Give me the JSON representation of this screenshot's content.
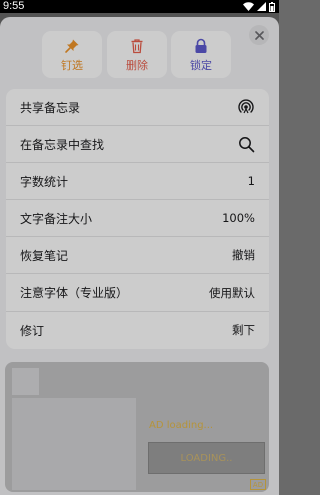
{
  "status_bar": {
    "time": "9:55"
  },
  "actions": {
    "pin": {
      "label": "钉选",
      "color": "#f0952a"
    },
    "delete": {
      "label": "删除",
      "color": "#e95f4d"
    },
    "lock": {
      "label": "锁定",
      "color": "#5e5bd0"
    }
  },
  "menu": {
    "items": [
      {
        "label": "共享备忘录",
        "value": "",
        "icon": "share-icon"
      },
      {
        "label": "在备忘录中查找",
        "value": "",
        "icon": "search-icon"
      },
      {
        "label": "字数统计",
        "value": "1"
      },
      {
        "label": "文字备注大小",
        "value": "100%"
      },
      {
        "label": "恢复笔记",
        "value": "撤销"
      },
      {
        "label": "注意字体（专业版）",
        "value": "使用默认"
      },
      {
        "label": "修订",
        "value": "剩下"
      }
    ]
  },
  "ad": {
    "loading_text": "AD loading...",
    "loading_button": "LOADING..",
    "badge": "AD"
  }
}
